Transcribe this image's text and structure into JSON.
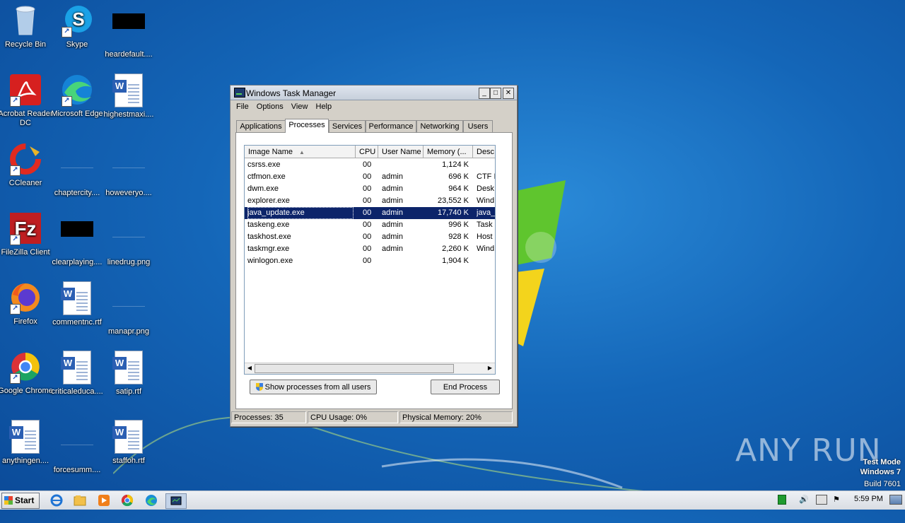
{
  "desktop": {
    "icons": [
      {
        "label": "Recycle Bin",
        "type": "recycle"
      },
      {
        "label": "Skype",
        "type": "skype"
      },
      {
        "label": "heardefault....",
        "type": "black"
      },
      {
        "label": "Acrobat Reader DC",
        "type": "acrobat"
      },
      {
        "label": "Microsoft Edge",
        "type": "edge"
      },
      {
        "label": "highestmaxi....",
        "type": "word"
      },
      {
        "label": "CCleaner",
        "type": "ccleaner"
      },
      {
        "label": "chaptercity....",
        "type": "blank"
      },
      {
        "label": "howeveryo....",
        "type": "blank"
      },
      {
        "label": "FileZilla Client",
        "type": "filezilla"
      },
      {
        "label": "clearplaying....",
        "type": "black"
      },
      {
        "label": "linedrug.png",
        "type": "blank"
      },
      {
        "label": "Firefox",
        "type": "firefox"
      },
      {
        "label": "commentnc.rtf",
        "type": "word"
      },
      {
        "label": "manapr.png",
        "type": "blank"
      },
      {
        "label": "Google Chrome",
        "type": "chrome"
      },
      {
        "label": "criticaleduca....",
        "type": "word"
      },
      {
        "label": "satip.rtf",
        "type": "word"
      },
      {
        "label": "anythingen....",
        "type": "word"
      },
      {
        "label": "forcesumm....",
        "type": "blank"
      },
      {
        "label": "staffoh.rtf",
        "type": "word"
      }
    ]
  },
  "taskmgr": {
    "title": "Windows Task Manager",
    "menu": [
      "File",
      "Options",
      "View",
      "Help"
    ],
    "tabs": [
      "Applications",
      "Processes",
      "Services",
      "Performance",
      "Networking",
      "Users"
    ],
    "active_tab": "Processes",
    "columns": [
      "Image Name",
      "CPU",
      "User Name",
      "Memory (...",
      "Desc"
    ],
    "rows": [
      {
        "name": "csrss.exe",
        "cpu": "00",
        "user": "",
        "mem": "1,124 K",
        "desc": ""
      },
      {
        "name": "ctfmon.exe",
        "cpu": "00",
        "user": "admin",
        "mem": "696 K",
        "desc": "CTF I"
      },
      {
        "name": "dwm.exe",
        "cpu": "00",
        "user": "admin",
        "mem": "964 K",
        "desc": "Desk"
      },
      {
        "name": "explorer.exe",
        "cpu": "00",
        "user": "admin",
        "mem": "23,552 K",
        "desc": "Wind"
      },
      {
        "name": "java_update.exe",
        "cpu": "00",
        "user": "admin",
        "mem": "17,740 K",
        "desc": "java_"
      },
      {
        "name": "taskeng.exe",
        "cpu": "00",
        "user": "admin",
        "mem": "996 K",
        "desc": "Task"
      },
      {
        "name": "taskhost.exe",
        "cpu": "00",
        "user": "admin",
        "mem": "928 K",
        "desc": "Host"
      },
      {
        "name": "taskmgr.exe",
        "cpu": "00",
        "user": "admin",
        "mem": "2,260 K",
        "desc": "Wind"
      },
      {
        "name": "winlogon.exe",
        "cpu": "00",
        "user": "",
        "mem": "1,904 K",
        "desc": ""
      }
    ],
    "selected_row": "java_update.exe",
    "show_all_button": "Show processes from all users",
    "end_process_button": "End Process",
    "status": {
      "processes": "Processes: 35",
      "cpu": "CPU Usage: 0%",
      "memory": "Physical Memory: 20%"
    }
  },
  "watermark": {
    "brand": "ANY RUN",
    "line1": "Test Mode",
    "line2": "Windows 7",
    "line3": "Build 7601"
  },
  "taskbar": {
    "start_label": "Start",
    "clock": "5:59 PM",
    "pinned": [
      "internet-explorer-icon",
      "explorer-folder-icon",
      "media-player-icon",
      "chrome-icon",
      "edge-icon",
      "task-manager-icon"
    ]
  },
  "colors": {
    "selection": "#0c246a",
    "desktop": "#1466b8"
  }
}
